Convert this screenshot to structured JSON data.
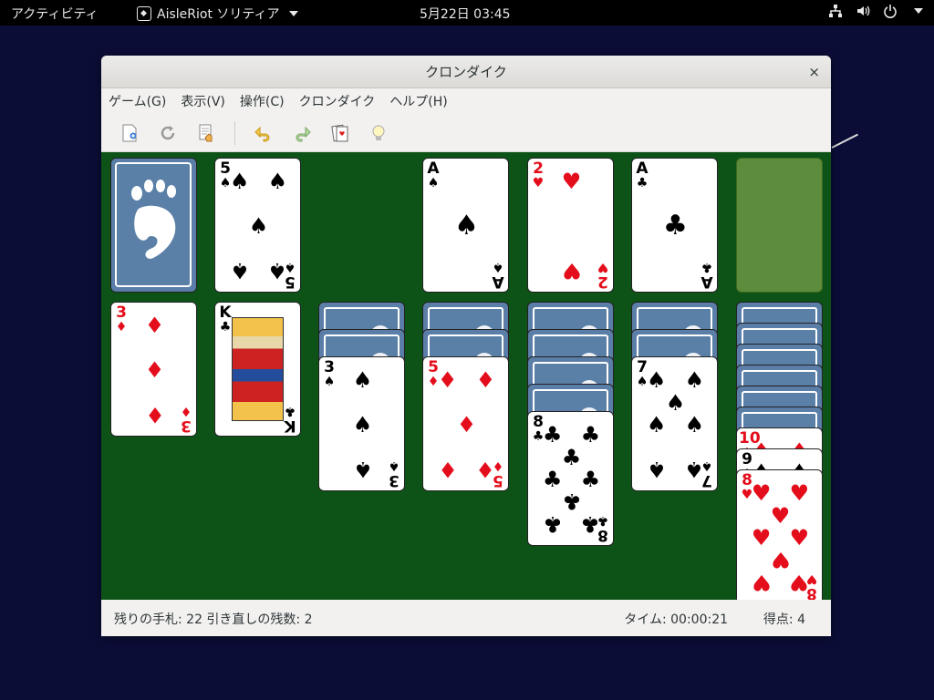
{
  "topbar": {
    "activities": "アクティビティ",
    "app_name": "AisleRiot ソリティア",
    "clock": "5月22日  03:45"
  },
  "window": {
    "title": "クロンダイク",
    "close": "×"
  },
  "menu": [
    "ゲーム(G)",
    "表示(V)",
    "操作(C)",
    "クロンダイク",
    "ヘルプ(H)"
  ],
  "toolbar": {
    "icons": [
      "new-game-icon",
      "restart-icon",
      "deal-icon",
      "undo-icon",
      "redo-icon",
      "change-game-icon",
      "hint-icon"
    ]
  },
  "colors": {
    "felt": "#0d5317",
    "card_back": "#5a7ea7",
    "red_suit": "#e40d1b",
    "foundation_empty": "#5e8c3d"
  },
  "status": {
    "left": "残りの手札: 22  引き直しの残数: 2",
    "time": "タイム: 00:00:21",
    "score": "得点:    4"
  },
  "cards": {
    "waste": {
      "rank": "5",
      "suit": "♠",
      "color": "black"
    },
    "foundations": [
      {
        "rank": "A",
        "suit": "♠",
        "color": "black"
      },
      {
        "rank": "2",
        "suit": "♥",
        "color": "red"
      },
      {
        "rank": "A",
        "suit": "♣",
        "color": "black"
      }
    ],
    "tableau": [
      {
        "hidden": 0,
        "face_up": [
          {
            "rank": "3",
            "suit": "♦",
            "color": "red"
          }
        ]
      },
      {
        "hidden": 0,
        "face_up": [
          {
            "rank": "K",
            "suit": "♣",
            "color": "black"
          }
        ]
      },
      {
        "hidden": 2,
        "face_up": [
          {
            "rank": "3",
            "suit": "♠",
            "color": "black"
          }
        ]
      },
      {
        "hidden": 2,
        "face_up": [
          {
            "rank": "5",
            "suit": "♦",
            "color": "red"
          }
        ]
      },
      {
        "hidden": 4,
        "face_up": [
          {
            "rank": "8",
            "suit": "♣",
            "color": "black"
          }
        ]
      },
      {
        "hidden": 2,
        "face_up": [
          {
            "rank": "7",
            "suit": "♠",
            "color": "black"
          }
        ]
      },
      {
        "hidden": 6,
        "face_up": [
          {
            "rank": "10",
            "suit": "♦",
            "color": "red"
          },
          {
            "rank": "9",
            "suit": "♠",
            "color": "black"
          },
          {
            "rank": "8",
            "suit": "♥",
            "color": "red"
          }
        ]
      }
    ]
  }
}
